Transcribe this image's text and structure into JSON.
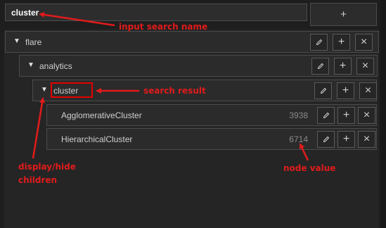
{
  "search": {
    "value": "cluster"
  },
  "add_root": {
    "label": "+"
  },
  "tree": {
    "root": {
      "label": "flare",
      "caret": "▼"
    },
    "child": {
      "label": "analytics",
      "caret": "▼"
    },
    "match": {
      "label": "cluster",
      "caret": "▼"
    },
    "leaves": [
      {
        "label": "AgglomerativeCluster",
        "value": "3938"
      },
      {
        "label": "HierarchicalCluster",
        "value": "6714"
      }
    ]
  },
  "buttons": {
    "edit_icon": "pencil-icon",
    "add_label": "+",
    "delete_label": "×"
  },
  "annotations": {
    "search_name": "input search name",
    "search_result": "search result",
    "toggle_line1": "display/hide",
    "toggle_line2": "children",
    "node_value": "node value"
  },
  "colors": {
    "annotation": "#e11b1b",
    "background": "#1e1e1e",
    "panel": "#252525"
  }
}
